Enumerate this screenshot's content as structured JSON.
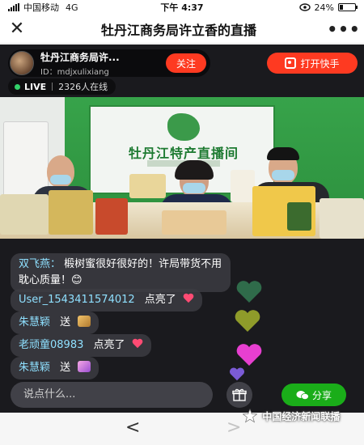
{
  "status_bar": {
    "carrier": "中国移动",
    "network": "4G",
    "time": "下午 4:37",
    "battery": "24%",
    "battery_level": 0.24
  },
  "nav_bar": {
    "close_icon": "close-icon",
    "title": "牡丹江商务局许立香的直播",
    "more_icon": "more-dots-icon"
  },
  "host": {
    "name": "牡丹江商务局许...",
    "id": "ID：mdjxulixiang",
    "follow_label": "关注"
  },
  "open_app": {
    "label": "打开快手"
  },
  "live": {
    "badge": "LIVE",
    "viewers": "2326人在线"
  },
  "video": {
    "banner_title": "牡丹江特产直播间"
  },
  "comments": [
    {
      "user": "双飞燕：",
      "text": "椴树蜜很好很好的！许局带货不用耽心质量！😊"
    },
    {
      "user": "User_1543411574012",
      "text": "点亮了",
      "extra": "heart"
    },
    {
      "user": "朱慧颖",
      "text": "送",
      "extra": "gift"
    },
    {
      "user": "老顽童08983",
      "text": "点亮了",
      "extra": "heart"
    },
    {
      "user": "朱慧颖",
      "text": "送",
      "extra": "gift"
    }
  ],
  "input": {
    "placeholder": "说点什么..."
  },
  "share": {
    "label": "分享"
  },
  "bottom_nav": {
    "back": "<",
    "forward": ">"
  },
  "watermark": "中国经济新闻联播",
  "colors": {
    "accent": "#fe3a21",
    "live_green": "#33d16a",
    "share_green": "#1aad19",
    "comment_user": "#8fe0ff"
  }
}
